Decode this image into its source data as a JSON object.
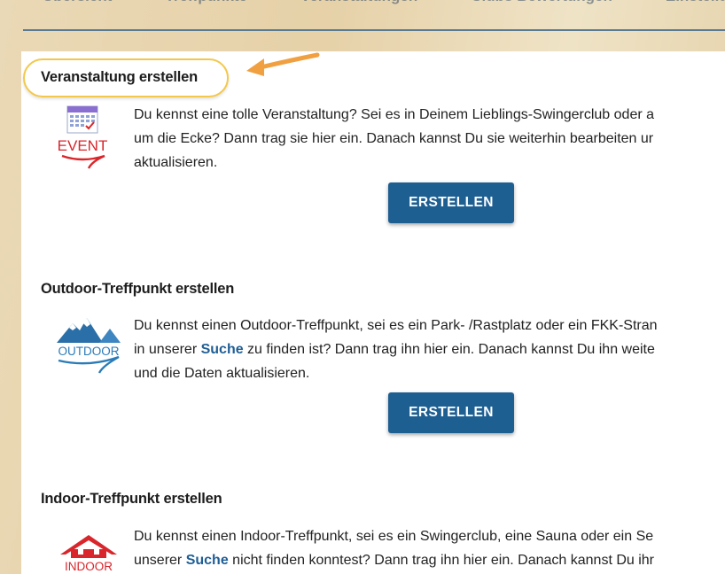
{
  "nav": {
    "items": [
      "Übersicht",
      "Treffpunkte",
      "Veranstaltungen",
      "Clubs Bewertungen",
      "Einstellungen"
    ]
  },
  "sections": [
    {
      "title": "Veranstaltung erstellen",
      "icon": "event-calendar-icon",
      "icon_label": "EVENT",
      "lines": [
        "Du kennst eine tolle Veranstaltung? Sei es in Deinem Lieblings-Swingerclub oder a",
        "um die Ecke? Dann trag sie hier ein. Danach kannst Du sie weiterhin bearbeiten ur",
        "aktualisieren."
      ],
      "button_label": "ERSTELLEN"
    },
    {
      "title": "Outdoor-Treffpunkt erstellen",
      "icon": "outdoor-mountains-icon",
      "icon_label": "OUTDOOR",
      "line1": "Du kennst einen Outdoor-Treffpunkt, sei es ein Park- /Rastplatz oder ein FKK-Stran",
      "line2_pre": "in unserer ",
      "line2_link": "Suche",
      "line2_post": " zu finden ist? Dann trag ihn hier ein. Danach kannst Du ihn weite",
      "line3": "und die Daten aktualisieren.",
      "button_label": "ERSTELLEN"
    },
    {
      "title": "Indoor-Treffpunkt erstellen",
      "icon": "indoor-house-icon",
      "icon_label": "INDOOR",
      "line1": "Du kennst einen Indoor-Treffpunkt, sei es ein Swingerclub, eine Sauna oder ein Se",
      "line2_pre": "unserer ",
      "line2_link": "Suche",
      "line2_post": " nicht finden konntest? Dann trag ihn hier ein. Danach kannst Du ihr"
    }
  ],
  "colors": {
    "button": "#1e5f92",
    "link": "#1f5e95",
    "highlight_ring": "#f3c84a",
    "arrow": "#f0a040",
    "icon_red": "#d9262c",
    "icon_blue": "#2a7bb8"
  }
}
